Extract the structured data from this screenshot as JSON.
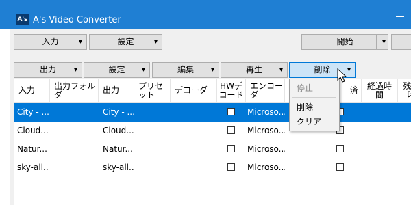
{
  "window": {
    "title": "A's Video Converter",
    "logo_text": "A's"
  },
  "toolbar1": [
    {
      "label": "入力",
      "arrow": "▾"
    },
    {
      "label": "設定",
      "arrow": "▾"
    },
    {
      "label": "開始",
      "arrow": "▾"
    }
  ],
  "toolbar2": [
    {
      "label": "出力",
      "arrow": "▾"
    },
    {
      "label": "設定",
      "arrow": "▾"
    },
    {
      "label": "編集",
      "arrow": "▾"
    },
    {
      "label": "再生",
      "arrow": "▾"
    },
    {
      "label": "削除",
      "arrow": "▾"
    }
  ],
  "table": {
    "columns": [
      "入力",
      "出力フォルダ",
      "出力",
      "プリセット",
      "デコーダ",
      "HWデコード",
      "エンコーダ",
      "済",
      "経過時間",
      "残り時"
    ],
    "rows": [
      {
        "input": "City - ...",
        "folder": "",
        "output": "City - ...",
        "encoder": "Microso..."
      },
      {
        "input": "Cloud...",
        "folder": "",
        "output": "Cloud...",
        "encoder": "Microso..."
      },
      {
        "input": "Natur...",
        "folder": "",
        "output": "Natur...",
        "encoder": "Microso..."
      },
      {
        "input": "sky-all...",
        "folder": "",
        "output": "sky-all...",
        "encoder": "Microso..."
      }
    ]
  },
  "context_menu": {
    "items": [
      {
        "label": "停止",
        "disabled": true
      },
      {
        "label": "削除",
        "disabled": false
      },
      {
        "label": "クリア",
        "disabled": false
      }
    ]
  },
  "colors": {
    "titlebar": "#1f7fd3",
    "selection": "#0078d7",
    "active_button": "#cce4f7"
  }
}
